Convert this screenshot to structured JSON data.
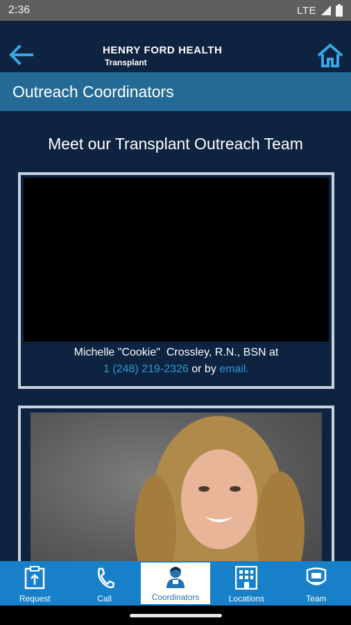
{
  "status_bar": {
    "time": "2:36",
    "network": "LTE"
  },
  "header": {
    "brand_name": "HENRY FORD HEALTH",
    "brand_sub": "Transplant"
  },
  "section": {
    "title": "Outreach Coordinators"
  },
  "content": {
    "heading": "Meet our Transplant Outreach Team",
    "cards": [
      {
        "name_line": "Michelle \"Cookie\"  Crossley, R.N., BSN at",
        "phone": "1 (248) 219-2326",
        "connector": " or by ",
        "email_label": "email."
      }
    ]
  },
  "tabs": [
    {
      "label": "Request",
      "icon": "clipboard-icon"
    },
    {
      "label": "Call",
      "icon": "phone-icon"
    },
    {
      "label": "Coordinators",
      "icon": "person-icon",
      "active": true
    },
    {
      "label": "Locations",
      "icon": "building-icon"
    },
    {
      "label": "Team",
      "icon": "badge-icon"
    }
  ],
  "colors": {
    "background": "#0d2340",
    "section_bar": "#236b96",
    "tab_bar": "#1780c8",
    "link": "#2e9ad6"
  }
}
